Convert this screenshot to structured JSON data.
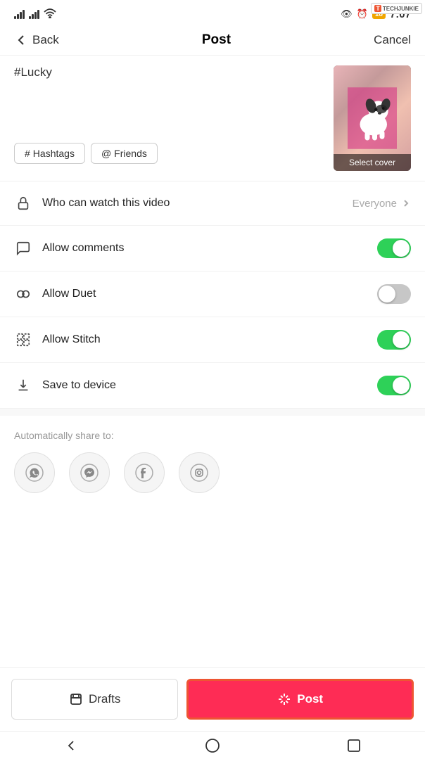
{
  "status": {
    "time": "7:07",
    "battery": "18",
    "brand": "TECHJUNKIE"
  },
  "header": {
    "back_label": "Back",
    "title": "Post",
    "cancel_label": "Cancel"
  },
  "caption": {
    "text": "#Lucky",
    "hashtags_label": "#Hashtags",
    "friends_label": "@Friends",
    "select_cover_label": "Select cover"
  },
  "settings": {
    "who_can_watch": {
      "label": "Who can watch this video",
      "value": "Everyone"
    },
    "allow_comments": {
      "label": "Allow comments",
      "enabled": true
    },
    "allow_duet": {
      "label": "Allow Duet",
      "enabled": false
    },
    "allow_stitch": {
      "label": "Allow Stitch",
      "enabled": true
    },
    "save_to_device": {
      "label": "Save to device",
      "enabled": true
    }
  },
  "share": {
    "label": "Automatically share to:"
  },
  "buttons": {
    "drafts": "Drafts",
    "post": "Post"
  }
}
